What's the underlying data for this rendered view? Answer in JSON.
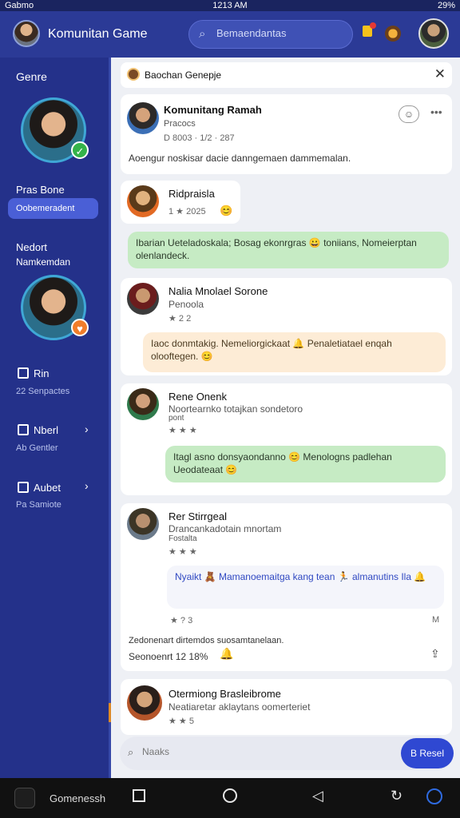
{
  "status": {
    "carrier": "Gabmo",
    "time": "1213 AM",
    "battery": "29%"
  },
  "topbar": {
    "title": "Komunitan Game",
    "search_placeholder": "Bemaendantas"
  },
  "sidebar": {
    "section_title": "Genre",
    "hero1_name": "Pras Bone",
    "hero1_button": "Oobemeradent",
    "section2_line1": "Nedort",
    "section2_line2": "Namkemdan",
    "items": [
      {
        "label": "Rin",
        "sub": "22 Senpactes"
      },
      {
        "label": "Nberl",
        "sub": "Ab Gentler"
      },
      {
        "label": "Aubet",
        "sub": "Pa Samiote"
      }
    ]
  },
  "banner": {
    "text": "Baochan Genepje"
  },
  "posts": [
    {
      "name": "Komunitang Ramah",
      "meta": "Pracocs",
      "rating": "D 8003 · 1/2 · 287",
      "body": "Aoengur noskisar dacie danngemaen dammemalan."
    },
    {
      "name": "Ridpraisla",
      "rating": "1 ★ 2025"
    },
    {
      "name": "Nalia Mnolael Sorone",
      "meta": "Penoola",
      "rating": "★ 2 2"
    },
    {
      "name": "Rene Onenk",
      "meta": "Noortearnko totajkan sondetoro",
      "meta2": "pont",
      "rating": "★ ★ ★"
    },
    {
      "name": "Rer Stirrgeal",
      "meta": "Drancankadotain mnortam",
      "meta2": "Fostalta",
      "rating": "★ ★ ★",
      "footer_rating": "★ ? 3",
      "footer_right": "M",
      "summary": "Zedonenart dirtemdos suosamtanelaan.",
      "summary2": "Seonoenrt 12 18%"
    },
    {
      "name": "Otermiong Brasleibrome",
      "meta": "Neatiaretar aklaytans oomerteriet",
      "rating": "★ ★ 5"
    }
  ],
  "bubbles": {
    "green1": "Ibarian Ueteladoskala; Bosag ekonrgras 😀 toniians, Nomeierptan olenlandeck.",
    "cream1": "Iaoc donmtakig. Nemeliorgickaat 🔔 Penaletiatael enqah olooftegen. 😊",
    "green2": "Itagl asno donsyaondanno 😊 Menologns padlehan Ueodateaat 😊",
    "blue1": "Nyaikt 🧸 Mamanoemaitga kang tean 🏃 almanutins Ila 🔔"
  },
  "composer": {
    "placeholder": "Naaks",
    "send_label": "B Resel"
  },
  "navbar": {
    "label": "Gomenessh"
  },
  "colors": {
    "primary": "#2b3a96",
    "sidebar": "#24318a",
    "accent_green": "#c6ebc4",
    "accent_cream": "#fdecd6",
    "send": "#2f48d2"
  }
}
